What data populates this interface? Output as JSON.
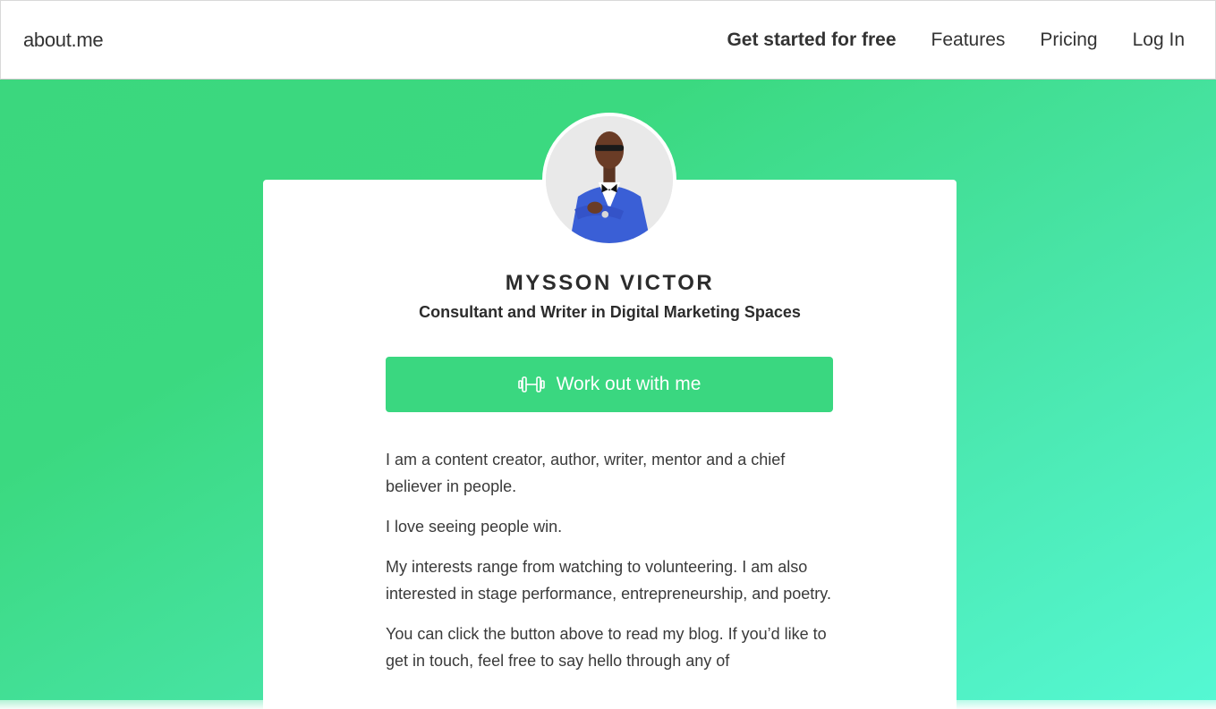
{
  "header": {
    "logo": "about.me",
    "nav": {
      "get_started": "Get started for free",
      "features": "Features",
      "pricing": "Pricing",
      "login": "Log In"
    }
  },
  "profile": {
    "name": "MYSSON VICTOR",
    "tagline": "Consultant and Writer in Digital Marketing Spaces",
    "cta": {
      "label": "Work out with me",
      "icon": "dumbbell-icon"
    },
    "bio": [
      "I am a content creator, author, writer, mentor and a chief believer in people.",
      "I love seeing people win.",
      "My interests range from watching to volunteering. I am also interested in stage performance, entrepreneurship, and poetry.",
      "You can click the button above to read my blog. If you’d like to get in touch, feel free to say hello through any of"
    ]
  },
  "colors": {
    "accent": "#3ad780",
    "hero_start": "#3bd77e",
    "hero_end": "#55f8d4",
    "text": "#2c2c2c"
  }
}
